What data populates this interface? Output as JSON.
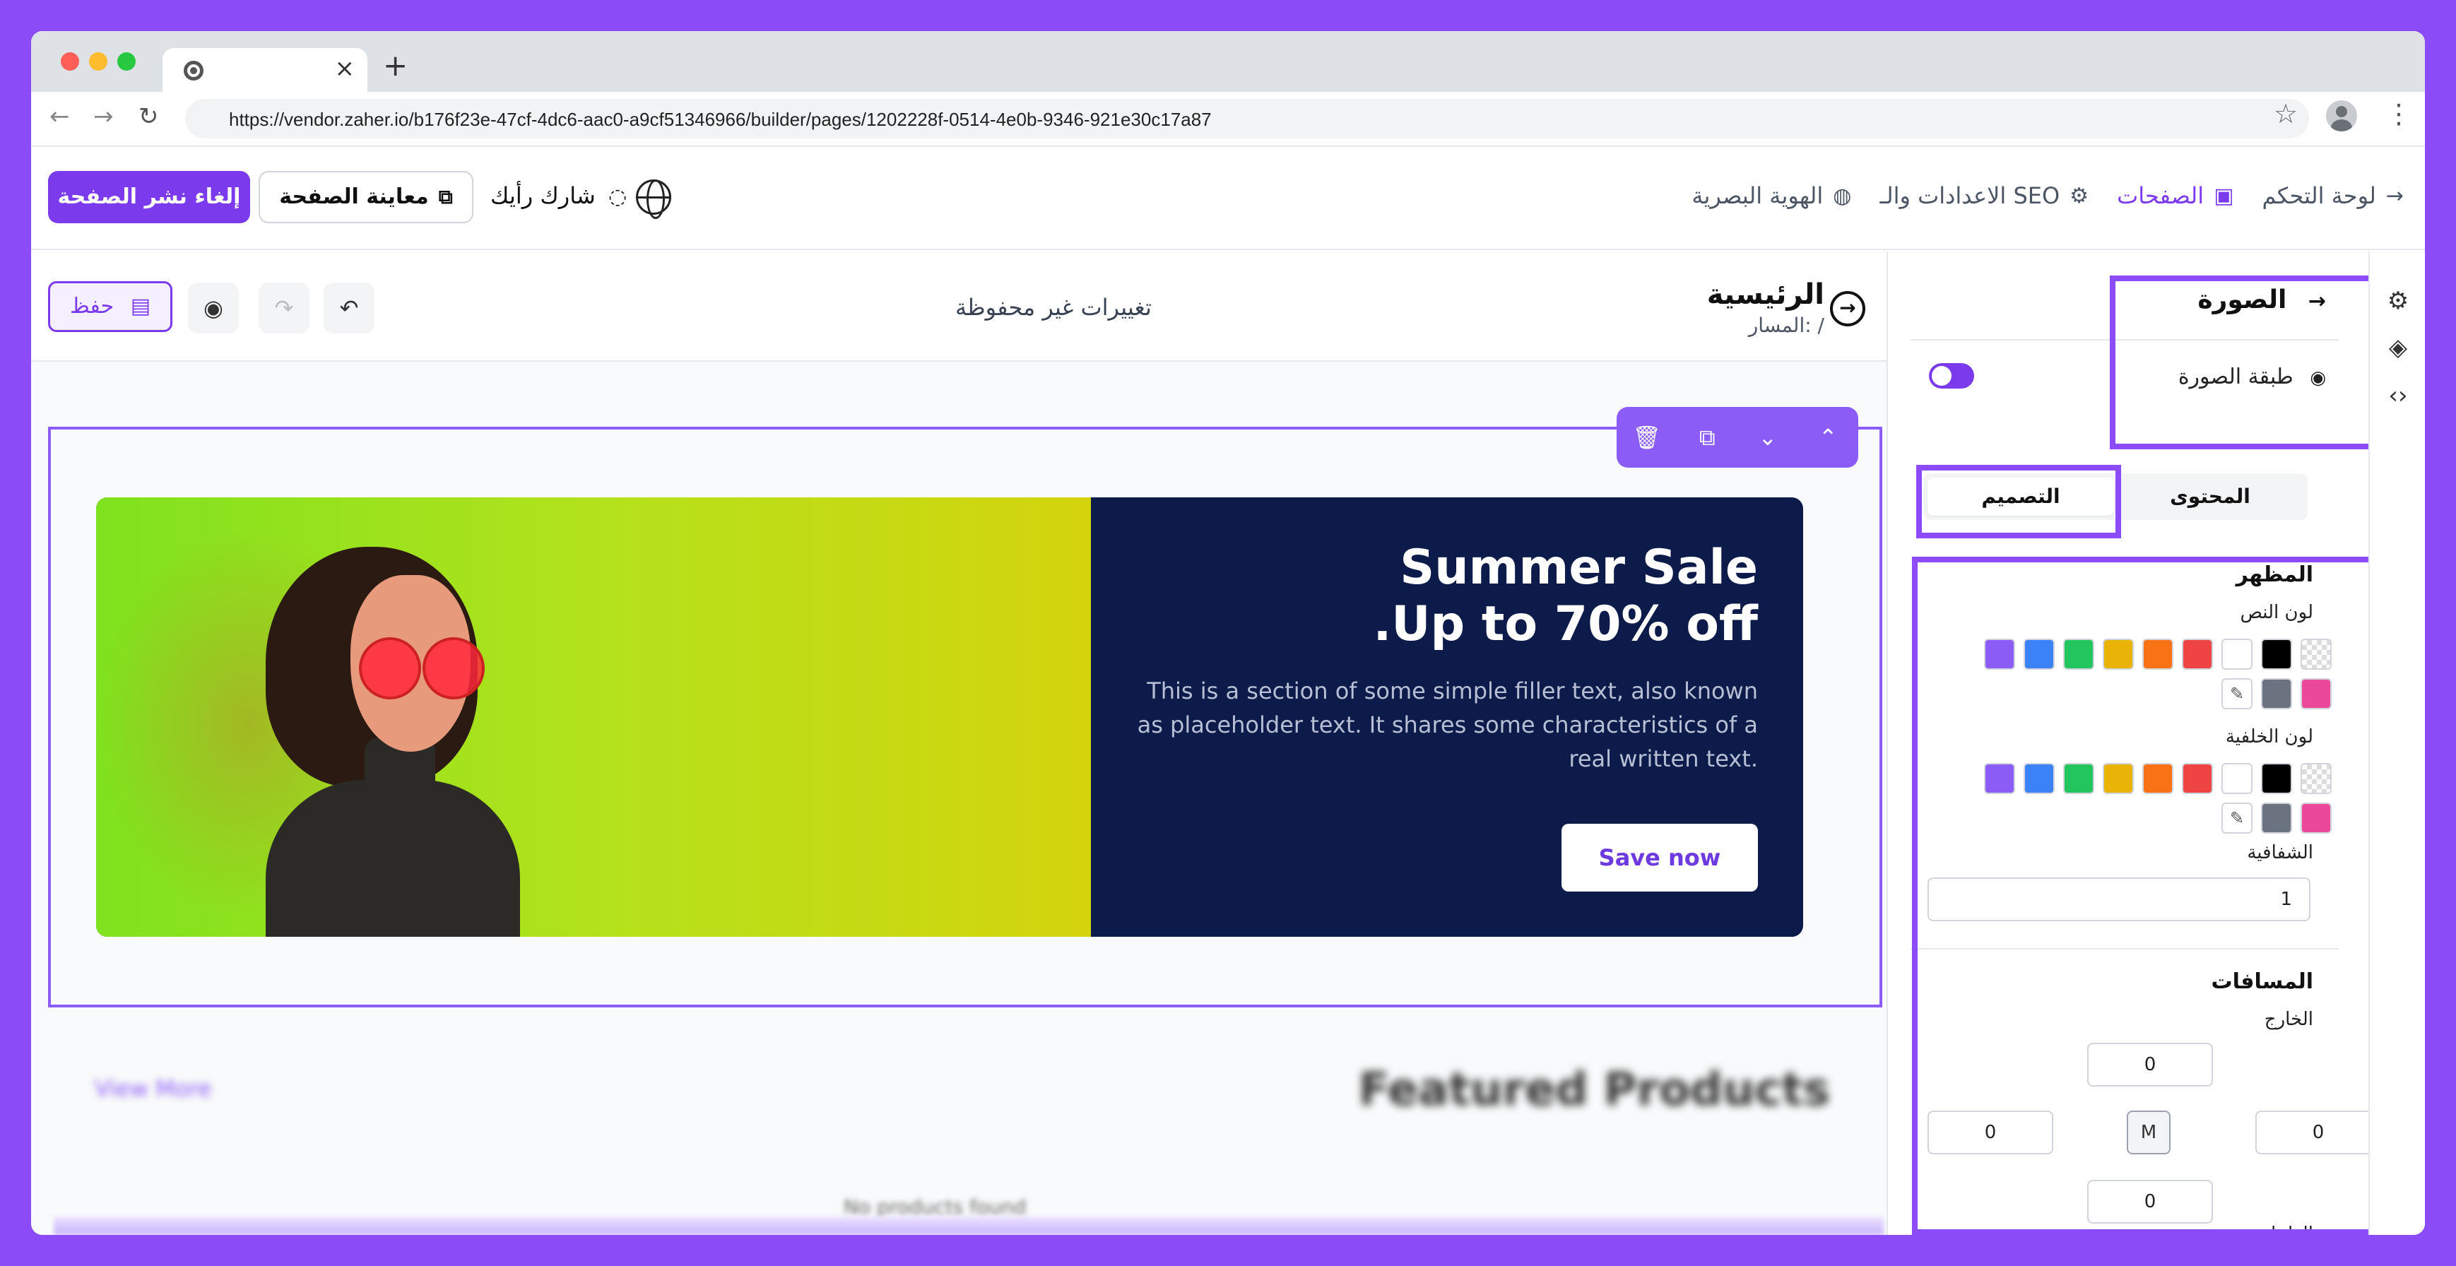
{
  "browser": {
    "tab_close": "×",
    "new_tab": "+",
    "url": "https://vendor.zaher.io/b176f23e-47cf-4dc6-aac0-a9cf51346966/builder/pages/1202228f-0514-4e0b-9346-921e30c17a87"
  },
  "header": {
    "unpublish_label": "إلغاء نشر الصفحة",
    "preview_label": "معاينة الصفحة",
    "feedback_label": "شارك رأيك",
    "nav": [
      {
        "label": "لوحة التحكم",
        "icon": "arrow-left-icon"
      },
      {
        "label": "الصفحات",
        "icon": "pages-icon",
        "active": true
      },
      {
        "label": "الاعدادات والـ SEO",
        "icon": "gear-icon"
      },
      {
        "label": "الهوية البصرية",
        "icon": "palette-icon"
      }
    ]
  },
  "editor": {
    "save_label": "حفظ",
    "unsaved_label": "تغييرات غير محفوظة",
    "page_title": "الرئيسية",
    "page_path": "المسار: /",
    "banner": {
      "heading_line1": "Summer Sale",
      "heading_line2": ".Up to 70% off",
      "description": "This is a section of some simple filler text, also known as placeholder text. It shares some characteristics of a real written text.",
      "button_label": "Save now"
    },
    "next_section": {
      "title": "Featured Products",
      "link": "View More",
      "empty": "No products found"
    }
  },
  "panel": {
    "title": "الصورة",
    "layer_label": "طبقة الصورة",
    "tabs": [
      "المحتوى",
      "التصميم"
    ],
    "active_tab": "التصميم",
    "appearance_heading": "المظهر",
    "text_color_label": "لون النص",
    "bg_color_label": "لون الخلفية",
    "opacity_label": "الشفافية",
    "opacity_value": "1",
    "spacing_heading": "المسافات",
    "outer_label": "الخارج",
    "inner_label": "الداخل",
    "margin": {
      "top": "0",
      "right": "0",
      "bottom": "0",
      "left": "0",
      "center": "M"
    },
    "colors": [
      "transparent",
      "#000000",
      "#ffffff",
      "#ef4444",
      "#f97316",
      "#eab308",
      "#22c55e",
      "#3b82f6",
      "#8b5cf6",
      "#ec4899",
      "#6b7280"
    ]
  }
}
